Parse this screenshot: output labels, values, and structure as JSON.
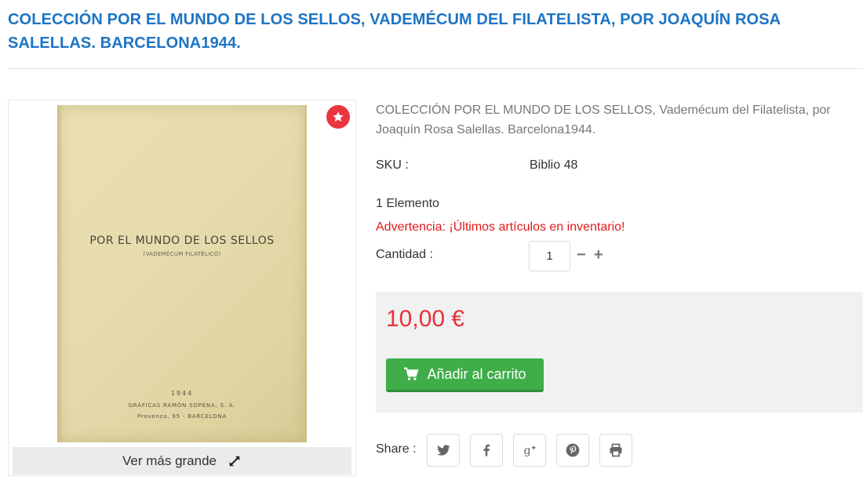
{
  "page": {
    "title": "COLECCIÓN POR EL MUNDO DE LOS SELLOS, VADEMÉCUM DEL FILATELISTA, POR JOAQUÍN ROSA SALELLAS. BARCELONA1944."
  },
  "image": {
    "cover_title": "POR EL MUNDO DE LOS SELLOS",
    "cover_subtitle": "(VADEMÉCUM FILATÉLICO)",
    "cover_year": "1944",
    "cover_publisher": "GRÁFICAS RAMÓN SOPENA, S. A.",
    "cover_address": "Provenza, 95  -  BARCELONA",
    "zoom_label": "Ver más grande",
    "badge_icon": "star-icon"
  },
  "product": {
    "description": "COLECCIÓN POR EL MUNDO DE LOS SELLOS, Vademécum del Filatelista, por Joaquín Rosa Salellas. Barcelona1944.",
    "sku_label": "SKU :",
    "sku_value": "Biblio 48",
    "stock_count": "1 Elemento",
    "stock_warning": "Advertencia: ¡Últimos artículos en inventario!",
    "quantity_label": "Cantidad :",
    "quantity_value": "1",
    "minus_symbol": "−",
    "plus_symbol": "+",
    "price": "10,00 €",
    "add_to_cart": "Añadir al carrito"
  },
  "share": {
    "label": "Share :",
    "buttons": [
      "twitter-icon",
      "facebook-icon",
      "google-plus-icon",
      "pinterest-icon",
      "print-icon"
    ]
  },
  "colors": {
    "title": "#1d74c5",
    "price": "#e5323a",
    "warning": "#e21b1b",
    "cart_button": "#3fae49",
    "badge": "#e8363f"
  }
}
